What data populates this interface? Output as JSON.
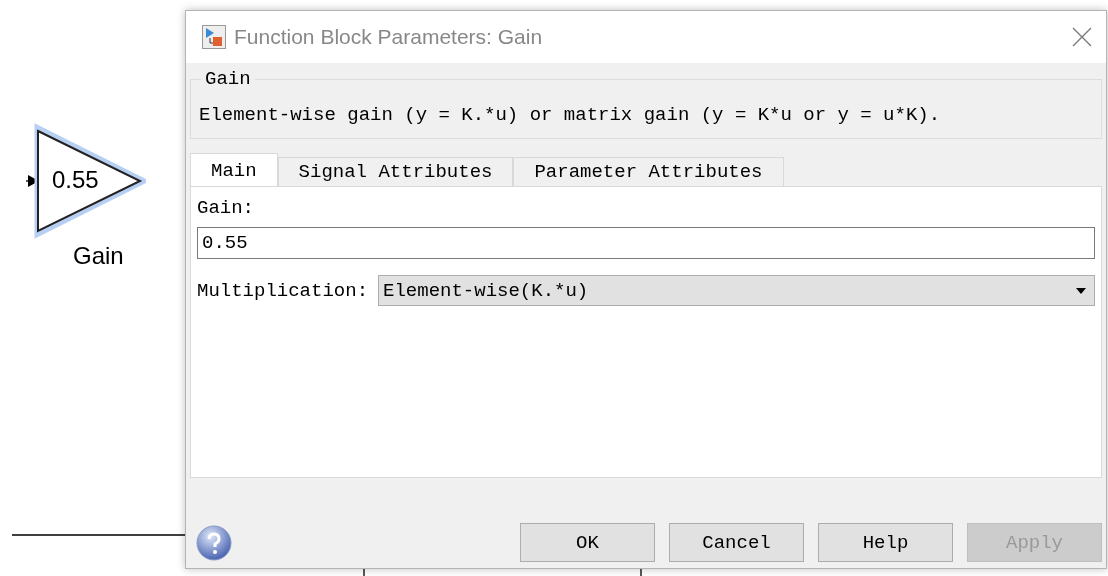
{
  "diagram": {
    "block": {
      "value": "0.55",
      "label": "Gain",
      "selected": true
    }
  },
  "dialog": {
    "title": "Function Block Parameters: Gain",
    "group": {
      "legend": "Gain",
      "description": "Element-wise gain (y = K.*u) or matrix gain (y = K*u or y = u*K)."
    },
    "tabs": [
      {
        "label": "Main",
        "selected": true
      },
      {
        "label": "Signal Attributes",
        "selected": false
      },
      {
        "label": "Parameter Attributes",
        "selected": false
      }
    ],
    "gain": {
      "label": "Gain:",
      "value": "0.55"
    },
    "multiplication": {
      "label": "Multiplication:",
      "value": "Element-wise(K.*u)"
    },
    "buttons": [
      {
        "label": "OK",
        "disabled": false
      },
      {
        "label": "Cancel",
        "disabled": false
      },
      {
        "label": "Help",
        "disabled": false
      },
      {
        "label": "Apply",
        "disabled": true
      }
    ]
  }
}
